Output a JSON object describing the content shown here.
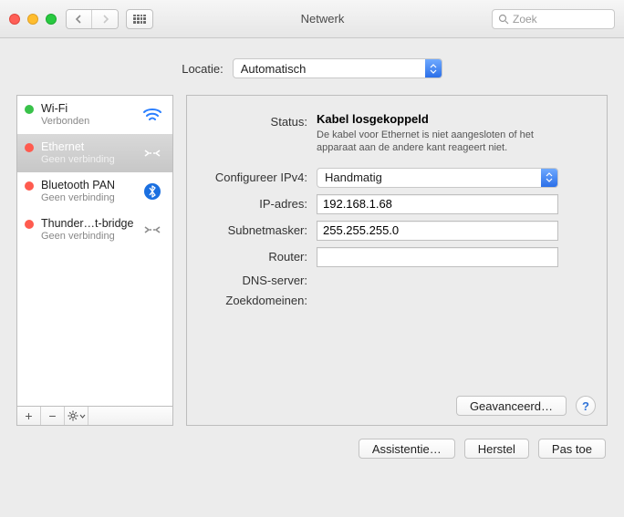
{
  "titlebar": {
    "title": "Netwerk",
    "search_placeholder": "Zoek"
  },
  "location": {
    "label": "Locatie:",
    "value": "Automatisch"
  },
  "sidebar": {
    "items": [
      {
        "name": "Wi-Fi",
        "sub": "Verbonden",
        "status": "green",
        "icon": "wifi",
        "selected": false
      },
      {
        "name": "Ethernet",
        "sub": "Geen verbinding",
        "status": "red",
        "icon": "ethernet",
        "selected": true
      },
      {
        "name": "Bluetooth PAN",
        "sub": "Geen verbinding",
        "status": "red",
        "icon": "bluetooth",
        "selected": false
      },
      {
        "name": "Thunder…t-bridge",
        "sub": "Geen verbinding",
        "status": "red",
        "icon": "ethernet-grey",
        "selected": false
      }
    ],
    "foot": {
      "add": "+",
      "remove": "−"
    }
  },
  "config": {
    "status_label": "Status:",
    "status_value": "Kabel losgekoppeld",
    "status_desc": "De kabel voor Ethernet is niet aangesloten of het apparaat aan de andere kant reageert niet.",
    "ipv4_label": "Configureer IPv4:",
    "ipv4_value": "Handmatig",
    "ip_label": "IP-adres:",
    "ip_value": "192.168.1.68",
    "mask_label": "Subnetmasker:",
    "mask_value": "255.255.255.0",
    "router_label": "Router:",
    "router_value": "",
    "dns_label": "DNS-server:",
    "search_label": "Zoekdomeinen:",
    "advanced": "Geavanceerd…",
    "help": "?"
  },
  "bottom": {
    "assist": "Assistentie…",
    "revert": "Herstel",
    "apply": "Pas toe"
  }
}
